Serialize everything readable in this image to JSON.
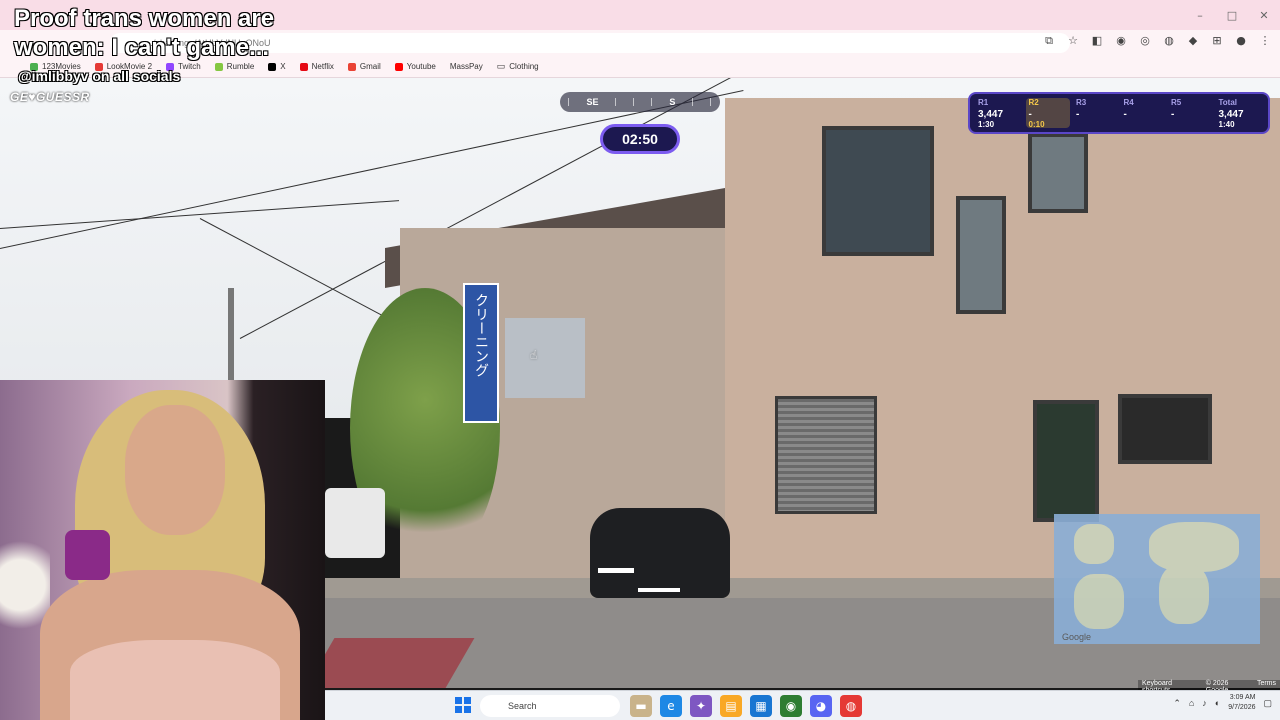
{
  "overlay": {
    "title_line1": "Proof trans women are",
    "title_line2": "women: I can't game...",
    "social": "@imlibbyv on all socials",
    "geoguessr_logo": "GE♥GUESSR"
  },
  "browser": {
    "url_text": "…/challenge/AtHbVdNUgONoU",
    "bookmarks": [
      {
        "label": "123Movies",
        "color": "#4caf50"
      },
      {
        "label": "LookMovie 2",
        "color": "#e53935"
      },
      {
        "label": "Twitch",
        "color": "#9146ff"
      },
      {
        "label": "Rumble",
        "color": "#85c742"
      },
      {
        "label": "X",
        "color": "#000000"
      },
      {
        "label": "Netflix",
        "color": "#e50914"
      },
      {
        "label": "Gmail",
        "color": "#ea4335"
      },
      {
        "label": "Youtube",
        "color": "#ff0000"
      },
      {
        "label": "MassPay",
        "color": "#ffffff"
      },
      {
        "label": "Clothing",
        "color": "#ffffff"
      }
    ],
    "window_controls": {
      "minimize": "–",
      "maximize": "□",
      "close": "✕"
    }
  },
  "game": {
    "compass_left": "SE",
    "compass_center": "S",
    "timer": "02:50",
    "rounds": [
      {
        "label": "R1",
        "score": "3,447",
        "time": "1:30",
        "active": false
      },
      {
        "label": "R2",
        "score": "-",
        "time": "0:10",
        "active": true
      },
      {
        "label": "R3",
        "score": "-",
        "time": "",
        "active": false
      },
      {
        "label": "R4",
        "score": "-",
        "time": "",
        "active": false
      },
      {
        "label": "R5",
        "score": "-",
        "time": "",
        "active": false
      }
    ],
    "total": {
      "label": "Total",
      "score": "3,447",
      "time": "1:40"
    },
    "map_logo": "Google",
    "footer": [
      "Keyboard shortcuts",
      "© 2026 Google",
      "Terms"
    ]
  },
  "scene": {
    "sign_text": "クリーニング"
  },
  "taskbar": {
    "search_placeholder": "Search",
    "time": "3:09 AM",
    "date": "9/7/2026"
  }
}
